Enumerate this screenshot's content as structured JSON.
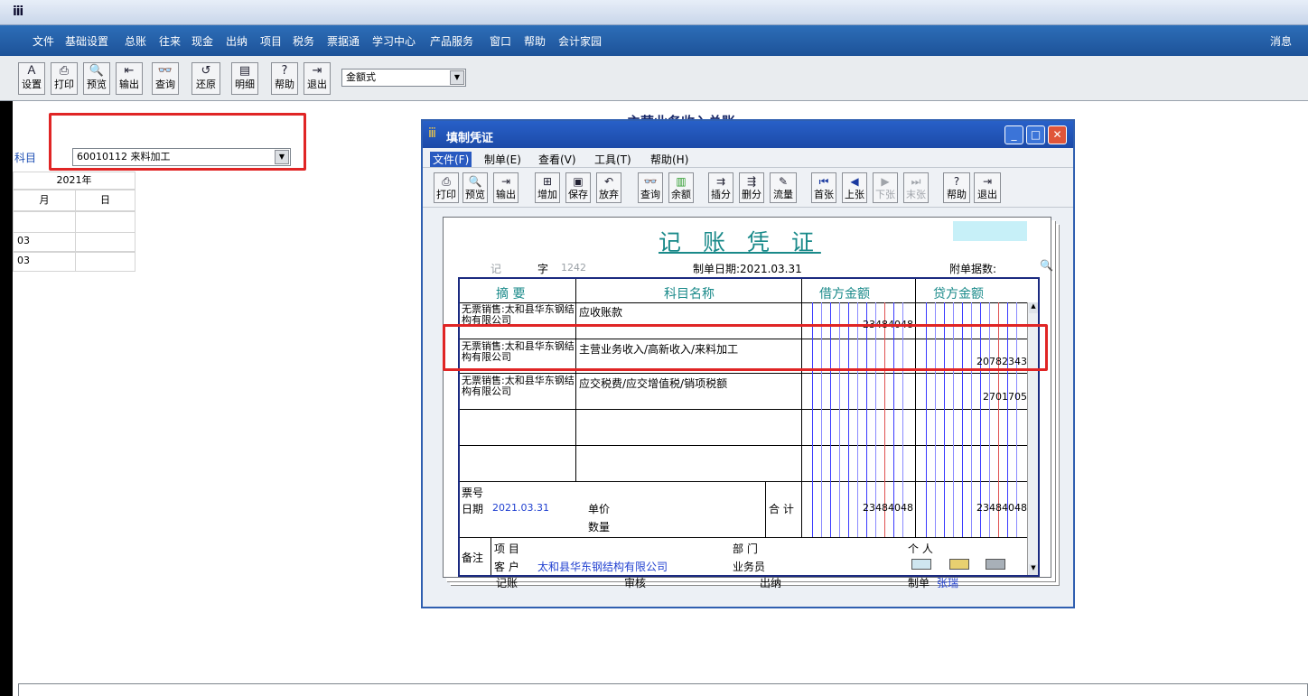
{
  "app": {
    "menu": [
      "文件",
      "基础设置",
      "总账",
      "往来",
      "现金",
      "出纳",
      "项目",
      "税务",
      "票据通",
      "学习中心",
      "产品服务",
      "窗口",
      "帮助",
      "会计家园"
    ],
    "menu_right": "消息",
    "toolbar": [
      "设置",
      "打印",
      "预览",
      "输出",
      "查询",
      "还原",
      "明细",
      "帮助",
      "退出"
    ],
    "format_select": "金额式",
    "report_title": "主营业务收入总账"
  },
  "ledger": {
    "subject_label": "科目",
    "subject_value": "60010112 来料加工",
    "year_header": "2021年",
    "month_header": "月",
    "day_header": "日",
    "rows": [
      "03",
      "03"
    ]
  },
  "voucher_window": {
    "title": "填制凭证",
    "menu": [
      "文件(F)",
      "制单(E)",
      "查看(V)",
      "工具(T)",
      "帮助(H)"
    ],
    "toolbar": [
      "打印",
      "预览",
      "输出",
      "增加",
      "保存",
      "放弃",
      "查询",
      "余额",
      "插分",
      "删分",
      "流量",
      "首张",
      "上张",
      "下张",
      "末张",
      "帮助",
      "退出"
    ],
    "heading": "记 账 凭 证",
    "type_label": "记",
    "word_label": "字",
    "number": "1242",
    "date_label": "制单日期:2021.03.31",
    "attach_label": "附单据数:",
    "col_summary": "摘 要",
    "col_account": "科目名称",
    "col_debit": "借方金额",
    "col_credit": "贷方金额",
    "entries": [
      {
        "summary": "无票销售:太和县华东钢结构有限公司",
        "account": "应收账款",
        "debit": "23484048",
        "credit": ""
      },
      {
        "summary": "无票销售:太和县华东钢结构有限公司",
        "account": "主营业务收入/高新收入/来料加工",
        "debit": "",
        "credit": "20782343"
      },
      {
        "summary": "无票销售:太和县华东钢结构有限公司",
        "account": "应交税费/应交增值税/销项税额",
        "debit": "",
        "credit": "2701705"
      }
    ],
    "ticket_label": "票号",
    "date2_label": "日期",
    "date2_value": "2021.03.31",
    "unit_price_label": "单价",
    "qty_label": "数量",
    "total_label": "合 计",
    "total_debit": "23484048",
    "total_credit": "23484048",
    "remark_label": "备注",
    "project_label": "项 目",
    "dept_label": "部 门",
    "person_label": "个 人",
    "customer_label": "客 户",
    "customer_value": "太和县华东钢结构有限公司",
    "salesman_label": "业务员",
    "bookkeep_label": "记账",
    "audit_label": "审核",
    "cashier_label": "出纳",
    "maker_label": "制单",
    "maker_value": "张瑞"
  }
}
